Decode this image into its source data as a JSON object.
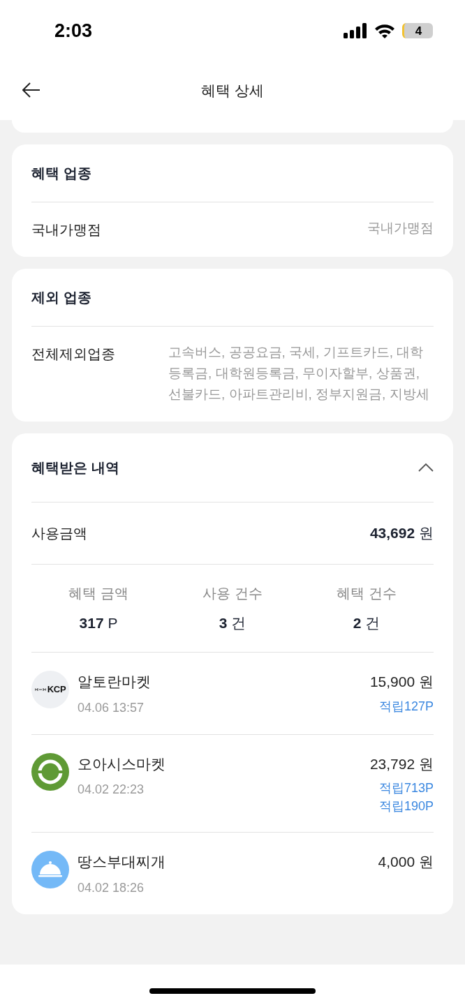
{
  "status_bar": {
    "time": "2:03",
    "battery": "4"
  },
  "header": {
    "title": "혜택 상세"
  },
  "sections": [
    {
      "kind": "info",
      "title": "혜택 업종",
      "rows": [
        {
          "label": "국내가맹점",
          "value": "국내가맹점"
        }
      ]
    },
    {
      "kind": "info",
      "title": "제외 업종",
      "rows": [
        {
          "label": "전체제외업종",
          "value": "고속버스, 공공요금, 국세, 기프트카드, 대학등록금, 대학원등록금, 무이자할부, 상품권, 선불카드, 아파트관리비, 정부지원금, 지방세"
        }
      ]
    },
    {
      "kind": "history",
      "title": "혜택받은 내역",
      "expanded": true,
      "total_label": "사용금액",
      "total_value": "**43,692** 원",
      "stats": [
        {
          "label": "혜택 금액",
          "value": "**317** P"
        },
        {
          "label": "사용 건수",
          "value": "**3** 건"
        },
        {
          "label": "혜택 건수",
          "value": "**2** 건"
        }
      ],
      "transactions": [
        {
          "kind": "kcp",
          "logo_text": "KCP",
          "merchant": "알토란마켓",
          "datetime": "04.06 13:57",
          "amount": "15,900 원",
          "rewards": [
            "적립127P"
          ]
        },
        {
          "kind": "oasis",
          "merchant": "오아시스마켓",
          "datetime": "04.02 22:23",
          "amount": "23,792 원",
          "rewards": [
            "적립713P",
            "적립190P"
          ]
        },
        {
          "kind": "food",
          "merchant": "땅스부대찌개",
          "datetime": "04.02 18:26",
          "amount": "4,000 원"
        }
      ]
    }
  ]
}
